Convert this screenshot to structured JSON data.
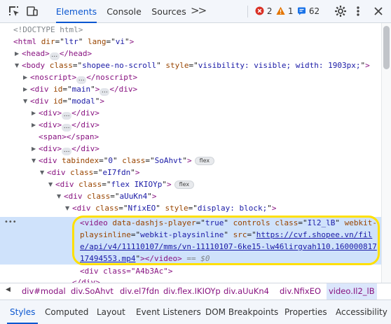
{
  "toolbar": {
    "tabs": [
      {
        "label": "Elements",
        "active": true
      },
      {
        "label": "Console",
        "active": false
      },
      {
        "label": "Sources",
        "active": false
      }
    ],
    "more_tabs_icon": "double-chevron-right",
    "error_count": "2",
    "warning_count": "1",
    "issue_count": "62",
    "colors": {
      "accent": "#0b57d0",
      "error": "#d93025",
      "warning": "#e37400",
      "info": "#1a73e8"
    }
  },
  "tree": {
    "doctype": "<!DOCTYPE html>",
    "html_open": {
      "tag": "html",
      "attrs": [
        {
          "name": "dir",
          "value": "ltr"
        },
        {
          "name": "lang",
          "value": "vi"
        }
      ]
    },
    "head": {
      "open": "<head>",
      "close": "</head>"
    },
    "body": {
      "tag": "body",
      "class_attr": "class",
      "class_val": "shopee-no-scroll",
      "style_attr": "style",
      "style_val": "visibility: visible; width: 1903px;"
    },
    "noscript": {
      "open": "<noscript>",
      "close": "</noscript>"
    },
    "div_main": {
      "tag": "div",
      "attr": "id",
      "val": "main",
      "close": "</div>"
    },
    "div_modal": {
      "tag": "div",
      "attr": "id",
      "val": "modal"
    },
    "div_plain_1": {
      "open": "<div>",
      "close": "</div>"
    },
    "div_plain_2": {
      "open": "<div>",
      "close": "</div>"
    },
    "span_line": "<span></span>",
    "div_plain_3": {
      "open": "<div>",
      "close": "</div>"
    },
    "div_tabindex": {
      "tag": "div",
      "attr1": "tabindex",
      "val1": "0",
      "attr2": "class",
      "val2": "SoAhvt",
      "badge": "flex"
    },
    "div_eI7fdn": {
      "tag": "div",
      "attr": "class",
      "val": "eI7fdn"
    },
    "div_flex": {
      "tag": "div",
      "attr": "class",
      "val": "flex IKIOYp",
      "badge": "flex"
    },
    "div_aUuKn4": {
      "tag": "div",
      "attr": "class",
      "val": "aUuKn4"
    },
    "div_NfixEO": {
      "tag": "div",
      "attr1": "class",
      "val1": "NfixEO",
      "attr2": "style",
      "val2": "display: block;"
    },
    "video": {
      "tag": "video",
      "attr_player": "data-dashjs-player",
      "val_player": "true",
      "attr_controls": "controls",
      "attr_class": "class",
      "val_class": "Il2_lB",
      "attr_webkit": "webkit-",
      "attr_webkit2": "playsinline",
      "val_webkit": "webkit-playsinline",
      "attr_src": "src",
      "src_part1": "https://cvf.shopee.vn/fil",
      "src_part2": "e/api/v4/11110107/mms/vn-11110107-6ke15-lw46lirgvah110.160000817",
      "src_part3": "17494553.mp4",
      "close": "</video>",
      "console_ref": "== $0"
    },
    "div_after": "<div class=\"A4b3Ac\">",
    "div_close": "</div>",
    "selection_dots": "•••"
  },
  "breadcrumbs": [
    "div#modal",
    "div.SoAhvt",
    "div.el7fdn",
    "div.flex.IKIOYp",
    "div.aUuKn4",
    "div.NfixEO",
    "video.Il2_lB"
  ],
  "subtabs": [
    {
      "label": "Styles",
      "active": true
    },
    {
      "label": "Computed",
      "active": false
    },
    {
      "label": "Layout",
      "active": false
    },
    {
      "label": "Event Listeners",
      "active": false
    },
    {
      "label": "DOM Breakpoints",
      "active": false
    },
    {
      "label": "Properties",
      "active": false
    },
    {
      "label": "Accessibility",
      "active": false
    }
  ]
}
